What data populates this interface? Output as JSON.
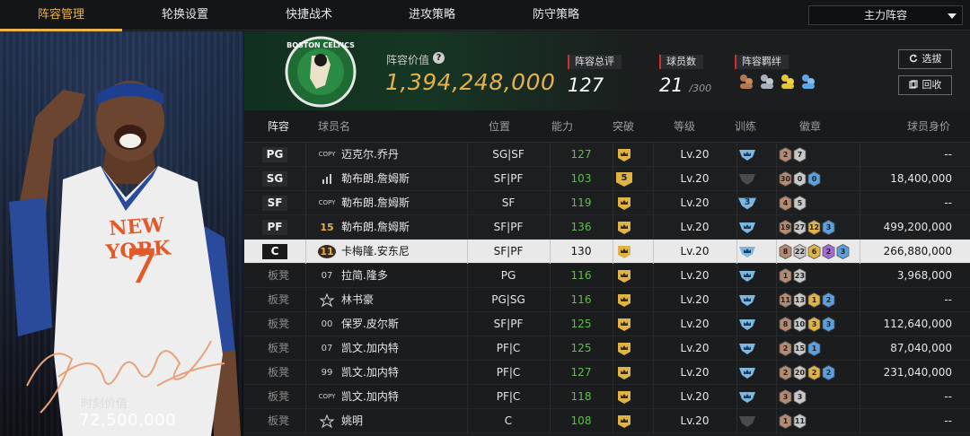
{
  "tabs": [
    {
      "label": "阵容管理",
      "active": true
    },
    {
      "label": "轮换设置",
      "active": false
    },
    {
      "label": "快捷战术",
      "active": false
    },
    {
      "label": "进攻策略",
      "active": false
    },
    {
      "label": "防守策略",
      "active": false
    }
  ],
  "lineup_select": {
    "value": "主力阵容"
  },
  "player_card": {
    "moment_label": "时刻价值",
    "moment_value": "72,500,000",
    "jersey_team": "NEW YORK",
    "jersey_number": "7"
  },
  "team": {
    "logo_text": "BOSTON CELTICS"
  },
  "header": {
    "value_label": "阵容价值",
    "value": "1,394,248,000",
    "total_rating_label": "阵容总评",
    "total_rating": "127",
    "player_count_label": "球员数",
    "player_count": "21",
    "player_count_max": "/300",
    "bond_label": "阵容羁绊"
  },
  "buttons": {
    "draft": "选拔",
    "recycle": "回收"
  },
  "columns": [
    "阵容",
    "球员名",
    "位置",
    "能力",
    "突破",
    "等级",
    "训练",
    "徽章",
    "球员身价"
  ],
  "colors": {
    "accent": "#e9b44c",
    "rating_green": "#5fbf4c",
    "tag_red": "#d0302c"
  },
  "rows": [
    {
      "role": "PG",
      "tag": "COPY",
      "tag_type": "copy",
      "name": "迈克尔.乔丹",
      "position": "SG|SF",
      "rating": "127",
      "breakthrough": "crown",
      "level": "Lv.20",
      "training": "crown",
      "badges": [
        {
          "t": "bronze",
          "n": "2"
        },
        {
          "t": "silver",
          "n": "7"
        }
      ],
      "value": "--"
    },
    {
      "role": "SG",
      "tag": "bars",
      "tag_type": "bars",
      "name": "勒布朗.詹姆斯",
      "position": "SF|PF",
      "rating": "103",
      "breakthrough": "5",
      "level": "Lv.20",
      "training": "none",
      "badges": [
        {
          "t": "bronze",
          "n": "30"
        },
        {
          "t": "silver",
          "n": "0"
        },
        {
          "t": "blue",
          "n": "0"
        }
      ],
      "value": "18,400,000"
    },
    {
      "role": "SF",
      "tag": "COPY",
      "tag_type": "copy",
      "name": "勒布朗.詹姆斯",
      "position": "SF",
      "rating": "119",
      "breakthrough": "crown",
      "level": "Lv.20",
      "training": "3",
      "badges": [
        {
          "t": "bronze",
          "n": "4"
        },
        {
          "t": "silver",
          "n": "5"
        }
      ],
      "value": "--"
    },
    {
      "role": "PF",
      "tag": "15",
      "tag_type": "gold",
      "name": "勒布朗.詹姆斯",
      "position": "SF|PF",
      "rating": "136",
      "breakthrough": "crown",
      "level": "Lv.20",
      "training": "crown",
      "badges": [
        {
          "t": "bronze",
          "n": "19"
        },
        {
          "t": "silver",
          "n": "27"
        },
        {
          "t": "gold",
          "n": "12"
        },
        {
          "t": "blue",
          "n": "3"
        }
      ],
      "value": "499,200,000"
    },
    {
      "role": "C",
      "tag": "11",
      "tag_type": "gold",
      "name": "卡梅隆.安东尼",
      "position": "SF|PF",
      "rating": "130",
      "breakthrough": "crown",
      "level": "Lv.20",
      "training": "crown",
      "badges": [
        {
          "t": "bronze",
          "n": "8"
        },
        {
          "t": "silver",
          "n": "22"
        },
        {
          "t": "gold",
          "n": "6"
        },
        {
          "t": "purple",
          "n": "2"
        },
        {
          "t": "blue",
          "n": "3"
        }
      ],
      "value": "266,880,000",
      "selected": true
    },
    {
      "role": "板凳",
      "tag": "07",
      "tag_type": "num",
      "name": "拉简.隆多",
      "position": "PG",
      "rating": "116",
      "breakthrough": "crown",
      "level": "Lv.20",
      "training": "crown",
      "badges": [
        {
          "t": "bronze",
          "n": "1"
        },
        {
          "t": "silver",
          "n": "23"
        }
      ],
      "value": "3,968,000"
    },
    {
      "role": "板凳",
      "tag": "star",
      "tag_type": "star",
      "name": "林书豪",
      "position": "PG|SG",
      "rating": "116",
      "breakthrough": "crown",
      "level": "Lv.20",
      "training": "crown",
      "badges": [
        {
          "t": "bronze",
          "n": "11"
        },
        {
          "t": "silver",
          "n": "13"
        },
        {
          "t": "gold",
          "n": "1"
        },
        {
          "t": "blue",
          "n": "2"
        }
      ],
      "value": "--"
    },
    {
      "role": "板凳",
      "tag": "00",
      "tag_type": "num",
      "name": "保罗.皮尔斯",
      "position": "SF|PF",
      "rating": "125",
      "breakthrough": "crown",
      "level": "Lv.20",
      "training": "crown",
      "badges": [
        {
          "t": "bronze",
          "n": "8"
        },
        {
          "t": "silver",
          "n": "10"
        },
        {
          "t": "gold",
          "n": "3"
        },
        {
          "t": "blue",
          "n": "3"
        }
      ],
      "value": "112,640,000"
    },
    {
      "role": "板凳",
      "tag": "07",
      "tag_type": "num",
      "name": "凯文.加内特",
      "position": "PF|C",
      "rating": "125",
      "breakthrough": "crown",
      "level": "Lv.20",
      "training": "crown",
      "badges": [
        {
          "t": "bronze",
          "n": "2"
        },
        {
          "t": "silver",
          "n": "15"
        },
        {
          "t": "blue",
          "n": "1"
        }
      ],
      "value": "87,040,000"
    },
    {
      "role": "板凳",
      "tag": "99",
      "tag_type": "num",
      "name": "凯文.加内特",
      "position": "PF|C",
      "rating": "127",
      "breakthrough": "crown",
      "level": "Lv.20",
      "training": "crown",
      "badges": [
        {
          "t": "bronze",
          "n": "2"
        },
        {
          "t": "silver",
          "n": "20"
        },
        {
          "t": "gold",
          "n": "2"
        },
        {
          "t": "blue",
          "n": "2"
        }
      ],
      "value": "231,040,000"
    },
    {
      "role": "板凳",
      "tag": "COPY",
      "tag_type": "copy",
      "name": "凯文.加内特",
      "position": "PF|C",
      "rating": "118",
      "breakthrough": "crown",
      "level": "Lv.20",
      "training": "crown",
      "badges": [
        {
          "t": "bronze",
          "n": "3"
        },
        {
          "t": "silver",
          "n": "3"
        }
      ],
      "value": "--"
    },
    {
      "role": "板凳",
      "tag": "star",
      "tag_type": "star",
      "name": "姚明",
      "position": "C",
      "rating": "108",
      "breakthrough": "crown",
      "level": "Lv.20",
      "training": "none",
      "badges": [
        {
          "t": "bronze",
          "n": "1"
        },
        {
          "t": "silver",
          "n": "11"
        }
      ],
      "value": "--"
    }
  ]
}
